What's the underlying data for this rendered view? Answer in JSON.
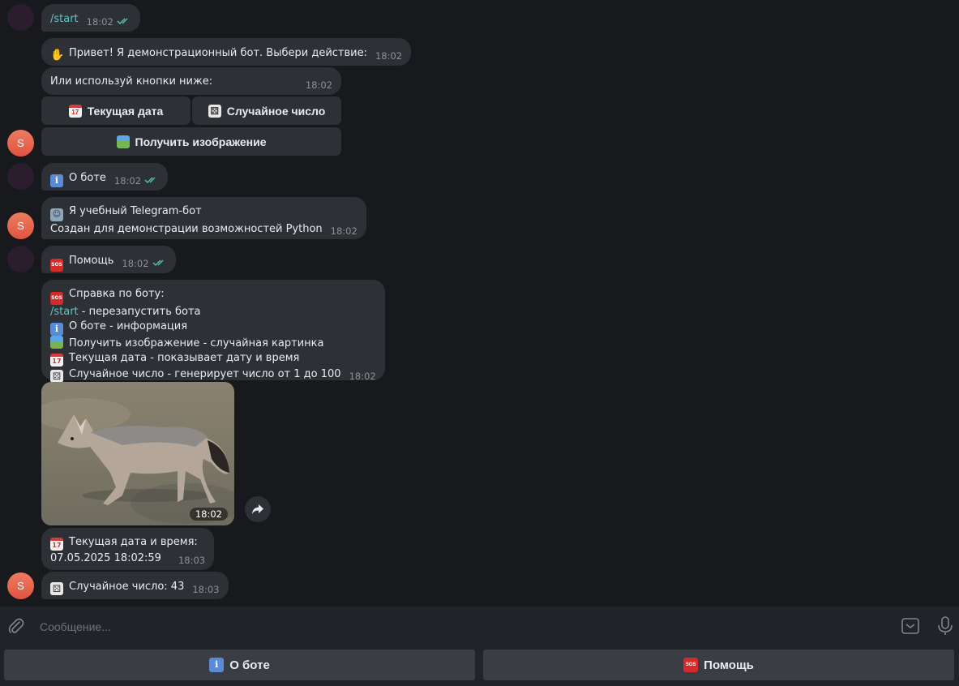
{
  "composer": {
    "placeholder": "Сообщение..."
  },
  "avatar_letter": "S",
  "messages": {
    "start": {
      "text": "/start",
      "time": "18:02"
    },
    "greeting": {
      "text": "Привет! Я демонстрационный бот. Выбери действие:",
      "time": "18:02"
    },
    "buttons_prompt": {
      "text": "Или используй кнопки ниже:",
      "time": "18:02"
    },
    "about_cmd": {
      "text": "О боте",
      "time": "18:02"
    },
    "about_reply": {
      "line1": "Я учебный Telegram-бот",
      "line2": "Создан для демонстрации возможностей Python",
      "time": "18:02"
    },
    "help_cmd": {
      "text": "Помощь",
      "time": "18:02"
    },
    "help_reply": {
      "title": "Справка по боту:",
      "start_cmd": "/start",
      "start_desc": " - перезапустить бота",
      "about": "О боте - информация",
      "image": "Получить изображение - случайная картинка",
      "date": "Текущая дата - показывает дату и время",
      "random": "Случайное число - генерирует число от 1 до 100",
      "time": "18:02"
    },
    "photo": {
      "time": "18:02"
    },
    "date_reply": {
      "line1": "Текущая дата и время:",
      "line2": "07.05.2025 18:02:59",
      "time": "18:03"
    },
    "random_reply": {
      "text": "Случайное число: 43",
      "time": "18:03"
    }
  },
  "inline_keyboard": {
    "date": "Текущая дата",
    "random": "Случайное число",
    "image": "Получить изображение"
  },
  "reply_keyboard": {
    "about": "О боте",
    "help": "Помощь"
  },
  "icons": {
    "info": "i",
    "sos": "SOS",
    "calendar": "17",
    "dice": "⚄"
  },
  "colors": {
    "background": "#17191d",
    "bubble": "#2d3136",
    "accent_link": "#5fc5c1",
    "read_ticks": "#4fc3a1",
    "bot_avatar": "#e25340"
  }
}
